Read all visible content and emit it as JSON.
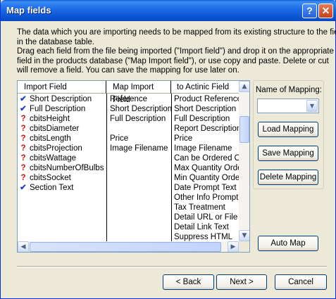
{
  "window": {
    "title": "Map fields",
    "help_glyph": "?",
    "close_glyph": "✕"
  },
  "description": [
    "The data which you are importing needs to be mapped from its existing structure to the fields",
    "in the database table.",
    "Drag each field from the file being imported (\"Import field\") and drop it on the appropriate",
    "field in the products database (\"Map Import field\"), or use copy and paste. Delete or cut",
    "will remove a field. You can save the mapping for use later on."
  ],
  "table": {
    "columns": [
      "Import Field",
      "Map Import Field",
      "to Actinic Field"
    ],
    "rows": [
      {
        "status": "check",
        "import": "Short Description",
        "map": "Reference",
        "actinic": "Product Reference"
      },
      {
        "status": "check",
        "import": "Full Description",
        "map": "Short Description",
        "actinic": "Short Description"
      },
      {
        "status": "question",
        "import": "cbitsHeight",
        "map": "Full Description",
        "actinic": "Full Description"
      },
      {
        "status": "question",
        "import": "cbitsDiameter",
        "map": "",
        "actinic": "Report Description"
      },
      {
        "status": "question",
        "import": "cbitsLength",
        "map": "Price",
        "actinic": "Price"
      },
      {
        "status": "question",
        "import": "cbitsProjection",
        "map": "Image Filename",
        "actinic": "Image Filename"
      },
      {
        "status": "question",
        "import": "cbitsWattage",
        "map": "",
        "actinic": "Can be Ordered Or"
      },
      {
        "status": "question",
        "import": "cbitsNumberOfBulbs",
        "map": "",
        "actinic": "Max Quantity Order"
      },
      {
        "status": "question",
        "import": "cbitsSocket",
        "map": "",
        "actinic": "Min Quantity Order"
      },
      {
        "status": "check",
        "import": "Section Text",
        "map": "",
        "actinic": "Date Prompt Text"
      },
      {
        "status": "",
        "import": "",
        "map": "",
        "actinic": "Other Info Prompt"
      },
      {
        "status": "",
        "import": "",
        "map": "",
        "actinic": "Tax Treatment"
      },
      {
        "status": "",
        "import": "",
        "map": "",
        "actinic": "Detail URL or File"
      },
      {
        "status": "",
        "import": "",
        "map": "",
        "actinic": "Detail Link Text"
      },
      {
        "status": "",
        "import": "",
        "map": "",
        "actinic": "Suppress HTML"
      }
    ],
    "status_glyphs": {
      "check": "✔",
      "question": "?"
    }
  },
  "mapping": {
    "label": "Name of Mapping:",
    "value": "",
    "load_label": "Load Mapping",
    "save_label": "Save Mapping",
    "delete_label": "Delete Mapping",
    "auto_map_label": "Auto Map"
  },
  "nav": {
    "back_label": "< Back",
    "next_label": "Next >",
    "cancel_label": "Cancel"
  },
  "colors": {
    "titlebar": "#0b55d4",
    "check": "#1c3ecf",
    "question": "#d01010",
    "face": "#ece9d8"
  }
}
